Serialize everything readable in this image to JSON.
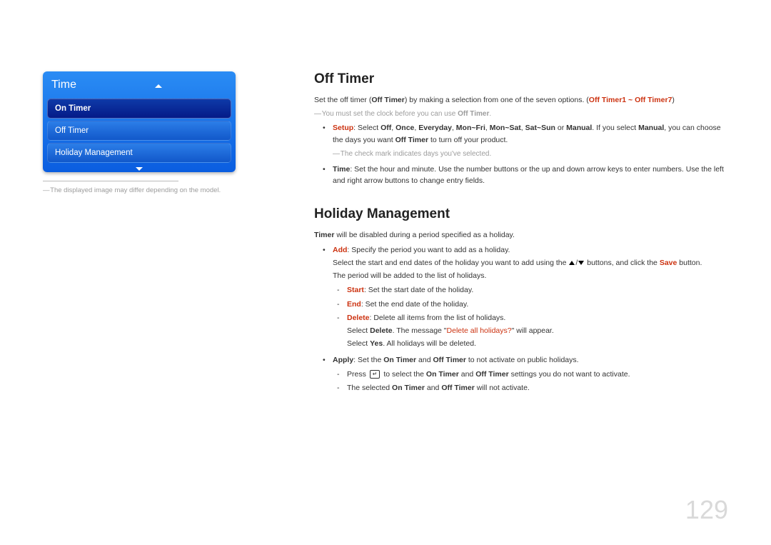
{
  "page_number": "129",
  "left": {
    "menu_title": "Time",
    "items": [
      "On Timer",
      "Off Timer",
      "Holiday Management"
    ],
    "footnote": "The displayed image may differ depending on the model."
  },
  "right": {
    "sec1": {
      "title": "Off Timer",
      "intro_pre": "Set the off timer (",
      "intro_bold1": "Off Timer",
      "intro_mid": ") by making a selection from one of the seven options. (",
      "intro_hl": "Off Timer1 ~ Off Timer7",
      "intro_end": ")",
      "note1_pre": "You must set the clock before you can use ",
      "note1_b": "Off Timer",
      "note1_end": ".",
      "setup_label": "Setup",
      "setup_text1": ": Select ",
      "setup_off": "Off",
      "setup_comma": ", ",
      "setup_once": "Once",
      "setup_everyday": "Everyday",
      "setup_monfri": "Mon~Fri",
      "setup_monsat": "Mon~Sat",
      "setup_satsun": "Sat~Sun",
      "setup_or": " or ",
      "setup_manual": "Manual",
      "setup_text2": ". If you select ",
      "setup_manual2": "Manual",
      "setup_text3": ", you can choose the days you want ",
      "setup_offtimer": "Off Timer",
      "setup_text4": " to turn off your product.",
      "note2": "The check mark indicates days you've selected.",
      "time_label": "Time",
      "time_text": ": Set the hour and minute. Use the number buttons or the up and down arrow keys to enter numbers. Use the left and right arrow buttons to change entry fields."
    },
    "sec2": {
      "title": "Holiday Management",
      "intro_b": "Timer",
      "intro_t": " will be disabled during a period specified as a holiday.",
      "add_label": "Add",
      "add_text": ": Specify the period you want to add as a holiday.",
      "add_line2a": "Select the start and end dates of the holiday you want to add using the ",
      "add_line2b": " buttons, and click the ",
      "add_save": "Save",
      "add_line2c": " button.",
      "add_line3": "The period will be added to the list of holidays.",
      "start_label": "Start",
      "start_text": ": Set the start date of the holiday.",
      "end_label": "End",
      "end_text": ": Set the end date of the holiday.",
      "delete_label": "Delete",
      "delete_text": ": Delete all items from the list of holidays.",
      "delete_l2a": "Select ",
      "delete_l2b": "Delete",
      "delete_l2c": ". The message \"",
      "delete_l2d": "Delete all holidays?",
      "delete_l2e": "\" will appear.",
      "delete_l3a": "Select ",
      "delete_l3b": "Yes",
      "delete_l3c": ". All holidays will be deleted.",
      "apply_label": "Apply",
      "apply_text1": ": Set the ",
      "apply_on": "On Timer",
      "apply_and": " and ",
      "apply_off": "Off Timer",
      "apply_text2": " to not activate on public holidays.",
      "apply_d1a": "Press ",
      "apply_d1b": " to select the ",
      "apply_d1c": " settings you do not want to activate.",
      "apply_d2a": "The selected ",
      "apply_d2c": " will not activate."
    }
  }
}
